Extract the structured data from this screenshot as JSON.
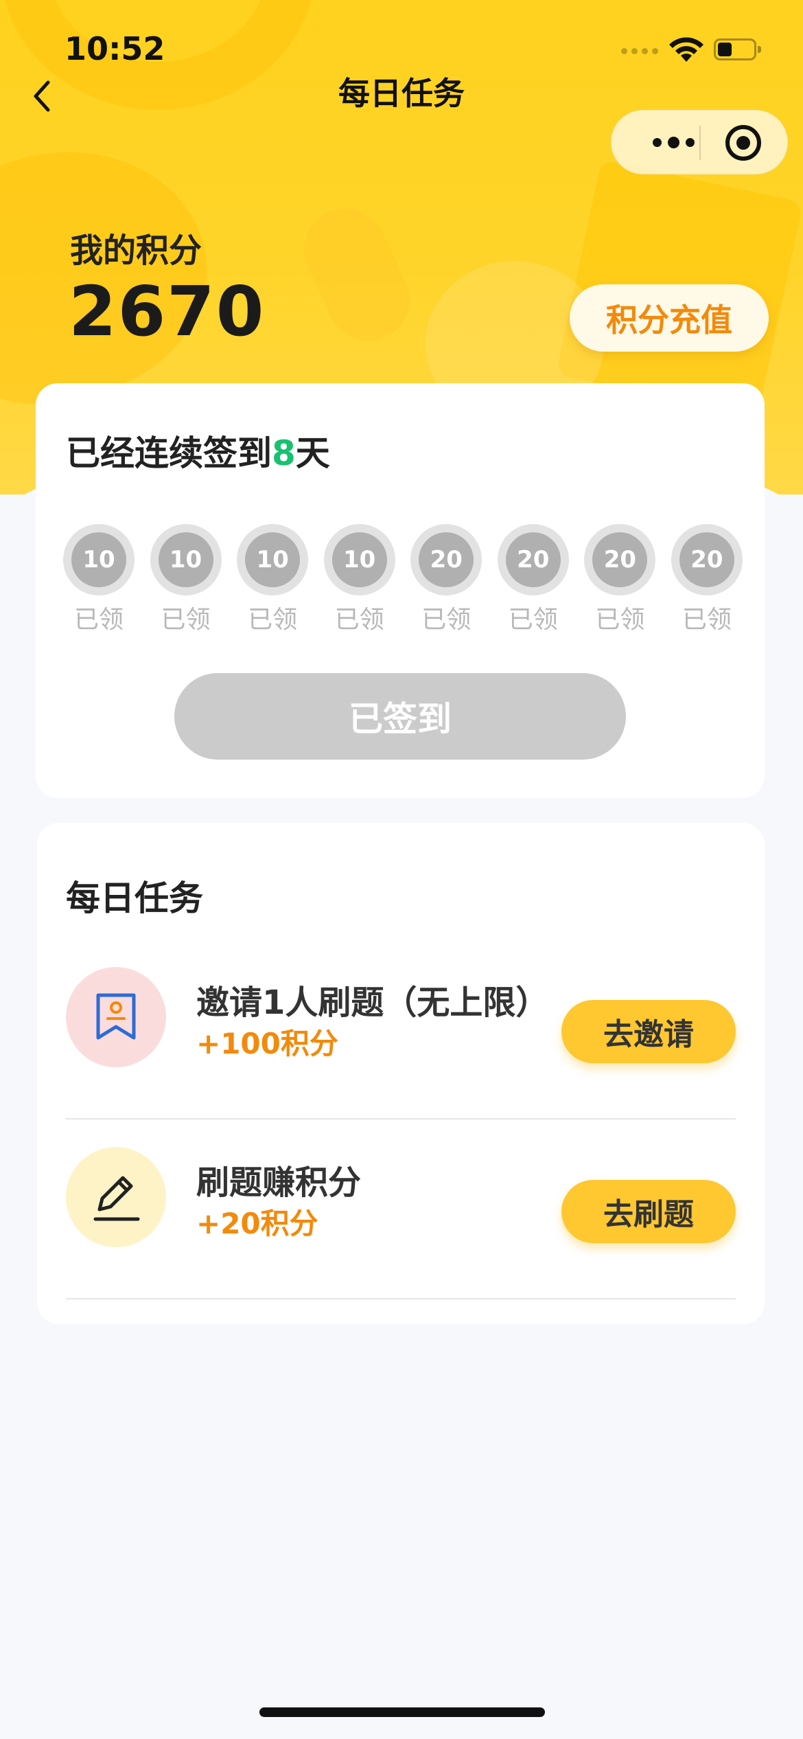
{
  "status_bar": {
    "time": "10:52"
  },
  "nav": {
    "title": "每日任务"
  },
  "points": {
    "label": "我的积分",
    "value": "2670",
    "recharge_label": "积分充值"
  },
  "signin": {
    "title_prefix": "已经连续签到",
    "days": "8",
    "title_suffix": "天",
    "days_list": [
      {
        "points": "10",
        "label": "已领"
      },
      {
        "points": "10",
        "label": "已领"
      },
      {
        "points": "10",
        "label": "已领"
      },
      {
        "points": "10",
        "label": "已领"
      },
      {
        "points": "20",
        "label": "已领"
      },
      {
        "points": "20",
        "label": "已领"
      },
      {
        "points": "20",
        "label": "已领"
      },
      {
        "points": "20",
        "label": "已领"
      }
    ],
    "button_label": "已签到"
  },
  "tasks": {
    "title": "每日任务",
    "items": [
      {
        "name": "邀请1人刷题（无上限）",
        "reward": "+100积分",
        "button": "去邀请",
        "icon": "bookmark-icon"
      },
      {
        "name": "刷题赚积分",
        "reward": "+20积分",
        "button": "去刷题",
        "icon": "pencil-icon"
      }
    ]
  },
  "colors": {
    "header_yellow": "#ffd21f",
    "accent_orange": "#f28a0b",
    "streak_green": "#18c16f",
    "task_button": "#ffc730",
    "signed_gray": "#cbcbcb"
  }
}
